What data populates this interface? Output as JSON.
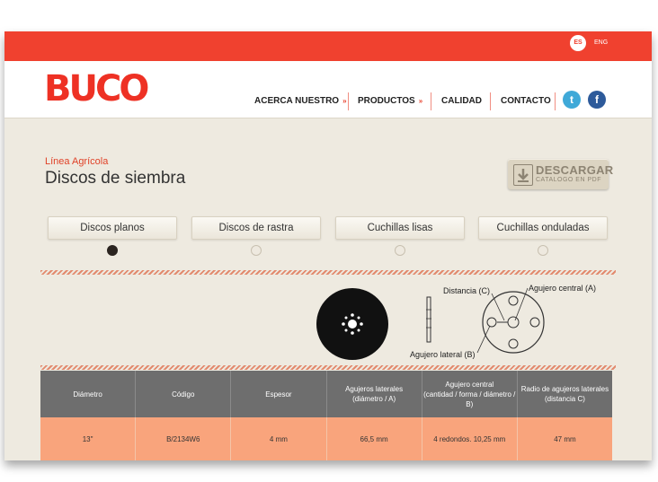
{
  "language": {
    "es": "ES",
    "en": "ENG"
  },
  "brand": {
    "logo": "BUCO"
  },
  "nav": [
    {
      "label": "ACERCA NUESTRO",
      "has_dropdown": true
    },
    {
      "label": "PRODUCTOS",
      "has_dropdown": true
    },
    {
      "label": "CALIDAD",
      "has_dropdown": false
    },
    {
      "label": "CONTACTO",
      "has_dropdown": false
    }
  ],
  "social": {
    "twitter_icon": "twitter-icon",
    "facebook_icon": "facebook-icon"
  },
  "page": {
    "subtitle": "Línea Agrícola",
    "title": "Discos de siembra"
  },
  "download": {
    "label": "DESCARGAR",
    "sublabel": "CATALOGO EN PDF"
  },
  "tabs": [
    {
      "label": "Discos planos",
      "active": true
    },
    {
      "label": "Discos de rastra",
      "active": false
    },
    {
      "label": "Cuchillas lisas",
      "active": false
    },
    {
      "label": "Cuchillas onduladas",
      "active": false
    }
  ],
  "diagram": {
    "distancia": "Distancia (C)",
    "agujero_central": "Agujero central (A)",
    "agujero_lateral": "Agujero lateral (B)"
  },
  "table": {
    "headers": [
      [
        "Diámetro"
      ],
      [
        "Código"
      ],
      [
        "Espesor"
      ],
      [
        "Agujeros laterales",
        "(diámetro / A)"
      ],
      [
        "Agujero central",
        "(cantidad / forma / diámetro / B)"
      ],
      [
        "Radio de agujeros laterales",
        "(distancia C)"
      ]
    ],
    "rows": [
      [
        "13\"",
        "B/2134W6",
        "4 mm",
        "66,5 mm",
        "4 redondos. 10,25 mm",
        "47 mm"
      ]
    ]
  },
  "colors": {
    "accent": "#f0412f",
    "header_gray": "#6e6e6e",
    "row_orange": "#f9a47c"
  }
}
